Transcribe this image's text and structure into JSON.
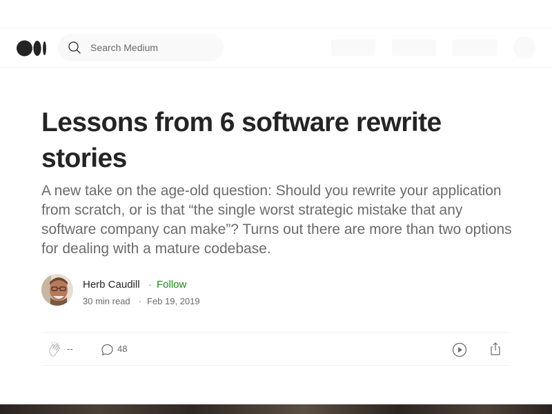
{
  "search": {
    "placeholder": "Search Medium"
  },
  "icons": {
    "logo": "medium-logo",
    "search": "search-icon",
    "clap": "clap-icon",
    "comment": "comment-icon",
    "listen": "play-icon",
    "share": "share-icon"
  },
  "article": {
    "title": "Lessons from 6 software rewrite stories",
    "subtitle": "A new take on the age-old question: Should you rewrite your application from scratch, or is that “the single worst strategic mistake that any software company can make”? Turns out there are more than two options for dealing with a mature codebase."
  },
  "author": {
    "name": "Herb Caudill",
    "separator": "·",
    "follow_label": "Follow",
    "read_time": "30 min read",
    "date": "Feb 19, 2019"
  },
  "actions": {
    "claps": "--",
    "comments": "48"
  },
  "colors": {
    "follow": "#1a8917",
    "text": "#242424",
    "muted": "#6b6b6b",
    "border": "#f2f2f2"
  }
}
